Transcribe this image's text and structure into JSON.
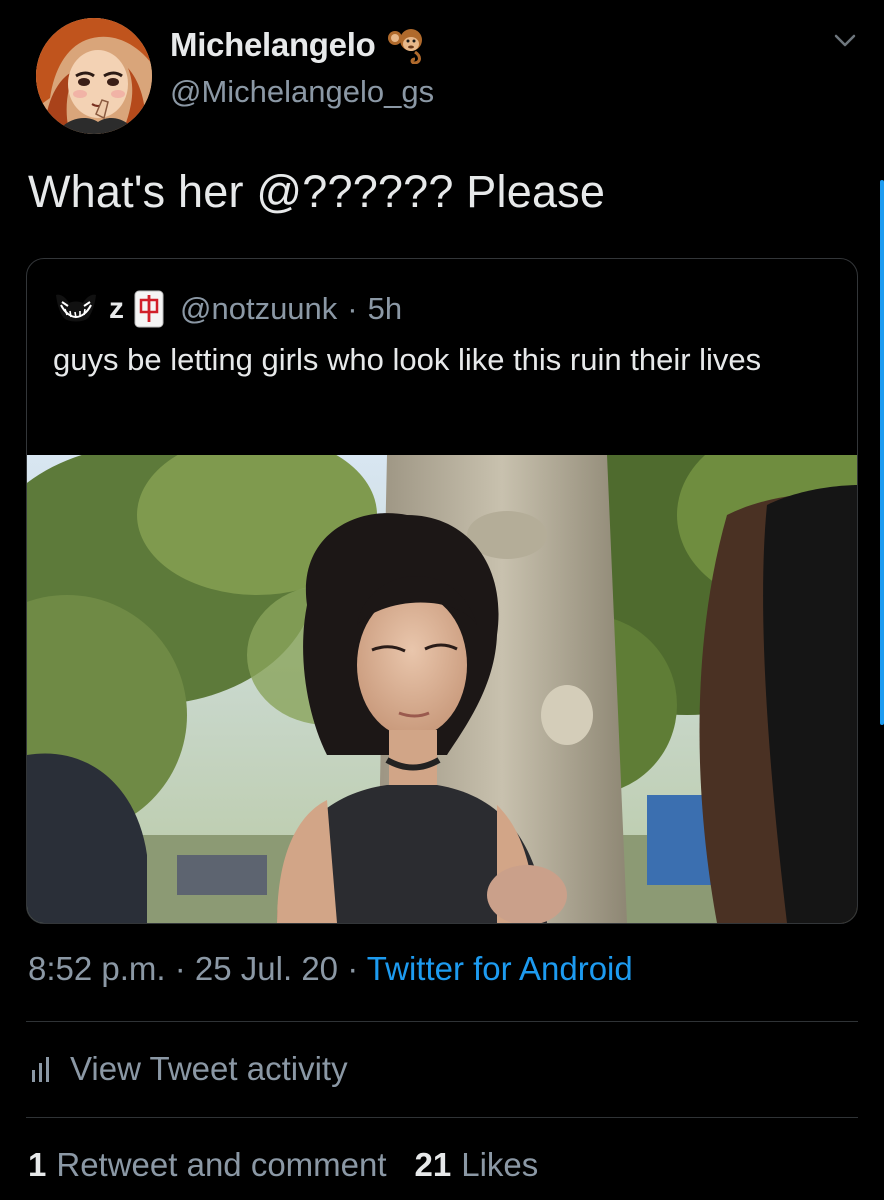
{
  "tweet": {
    "author": {
      "display_name": "Michelangelo",
      "username": "@Michelangelo_gs",
      "badge_icon": "monkey-icon"
    },
    "text": "What's her @?????? Please",
    "quoted": {
      "name": "z",
      "handle": "@notzuunk",
      "separator": "·",
      "time": "5h",
      "text": "guys be letting girls who look like this ruin their lives",
      "name_icons": [
        "ghost-icon",
        "mahjong-tile-icon"
      ]
    },
    "meta": {
      "time": "8:52 p.m.",
      "separator": "·",
      "date": "25 Jul. 20",
      "separator2": "·",
      "source": "Twitter for Android"
    },
    "activity_label": "View Tweet activity",
    "stats": {
      "retweets_count": "1",
      "retweets_label": "Retweet and comment",
      "likes_count": "21",
      "likes_label": "Likes"
    }
  },
  "colors": {
    "background": "#000000",
    "primary_text": "#e7e9ea",
    "secondary_text": "#8b98a5",
    "accent": "#1d9bf0",
    "border": "#333639"
  }
}
